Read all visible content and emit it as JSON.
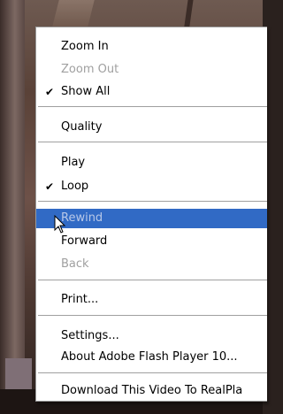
{
  "menu": {
    "items": [
      {
        "label": "Zoom In",
        "checked": false,
        "disabled": false
      },
      {
        "label": "Zoom Out",
        "checked": false,
        "disabled": true
      },
      {
        "label": "Show All",
        "checked": true,
        "disabled": false
      },
      {
        "label": "Quality",
        "checked": false,
        "disabled": false
      },
      {
        "label": "Play",
        "checked": false,
        "disabled": false
      },
      {
        "label": "Loop",
        "checked": true,
        "disabled": false
      },
      {
        "label": "Rewind",
        "checked": false,
        "disabled": false,
        "highlighted": true
      },
      {
        "label": "Forward",
        "checked": false,
        "disabled": false
      },
      {
        "label": "Back",
        "checked": false,
        "disabled": true
      },
      {
        "label": "Print...",
        "checked": false,
        "disabled": false
      },
      {
        "label": "Settings...",
        "checked": false,
        "disabled": false
      },
      {
        "label": "About Adobe Flash Player 10...",
        "checked": false,
        "disabled": false
      },
      {
        "label": "Download This Video To RealPla",
        "checked": false,
        "disabled": false
      }
    ],
    "check_glyph": "✔",
    "highlight_color": "#316ac5"
  }
}
